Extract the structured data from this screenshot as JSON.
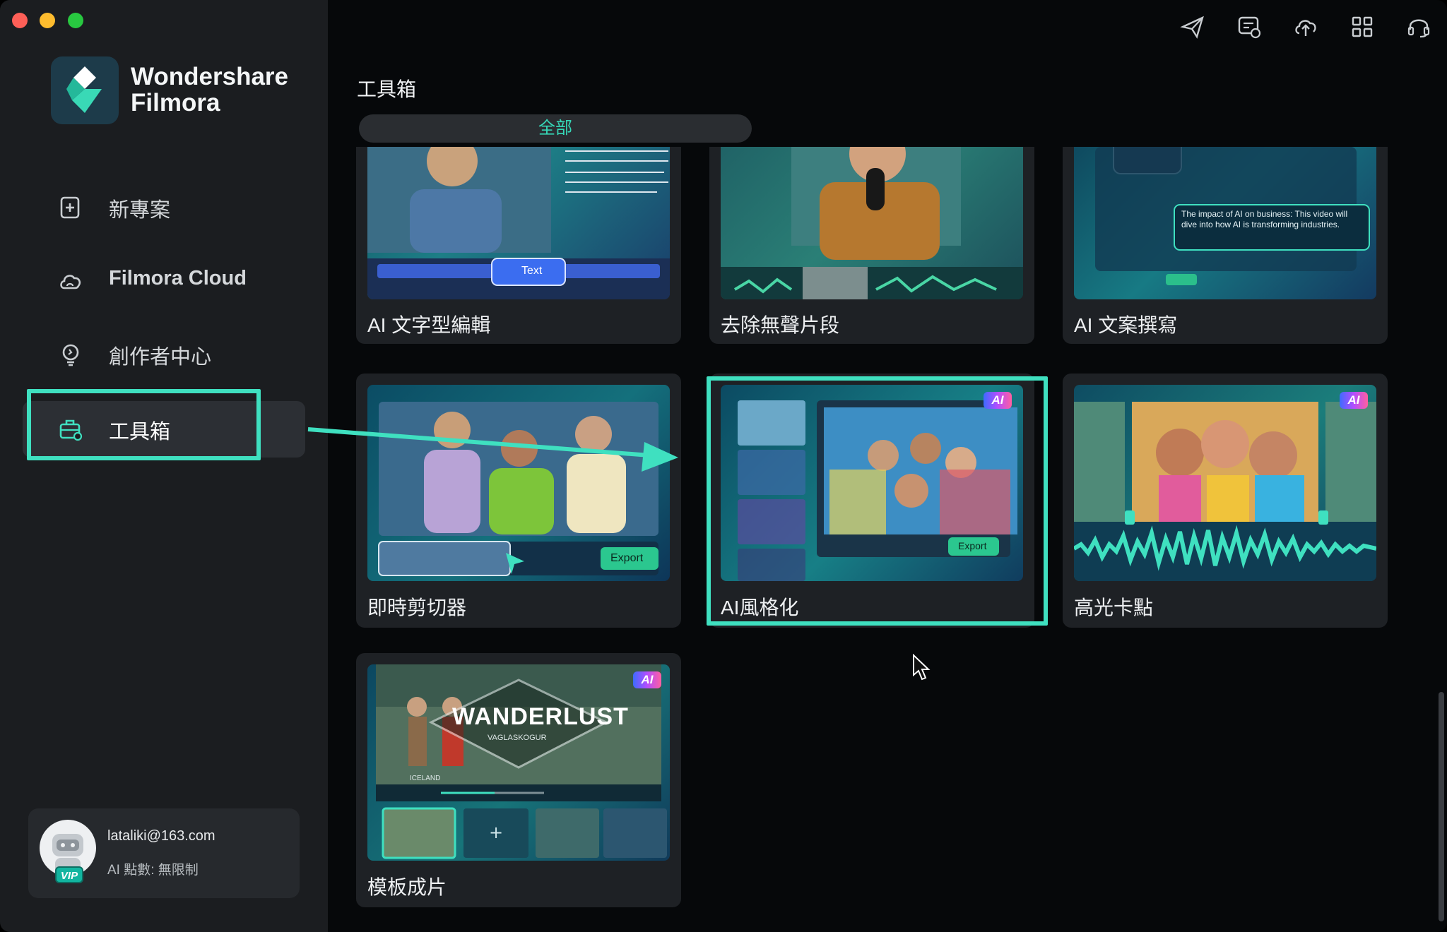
{
  "window": {
    "app_name_line1": "Wondershare",
    "app_name_line2": "Filmora"
  },
  "sidebar": {
    "items": [
      {
        "label": "新專案",
        "icon": "new-project-icon"
      },
      {
        "label": "Filmora Cloud",
        "icon": "cloud-icon"
      },
      {
        "label": "創作者中心",
        "icon": "lightbulb-icon"
      },
      {
        "label": "工具箱",
        "icon": "toolbox-icon",
        "active": true
      }
    ]
  },
  "user": {
    "email": "lataliki@163.com",
    "credits": "AI 點數: 無限制",
    "badge": "VIP"
  },
  "topbar": {
    "icons": [
      "send-icon",
      "message-icon",
      "cloud-upload-icon",
      "grid-icon",
      "headset-icon"
    ]
  },
  "main": {
    "title": "工具箱",
    "tab": "全部",
    "cards": [
      {
        "label": "AI 文字型編輯",
        "thumb_text": "Text"
      },
      {
        "label": "去除無聲片段"
      },
      {
        "label": "AI 文案撰寫",
        "thumb_text": "The impact of AI on business: This video will dive into how AI is transforming industries."
      },
      {
        "label": "即時剪切器",
        "thumb_button": "Export"
      },
      {
        "label": "AI風格化",
        "thumb_button": "Export",
        "badge": "AI"
      },
      {
        "label": "高光卡點",
        "badge": "AI"
      },
      {
        "label": "模板成片",
        "badge": "AI",
        "thumb_title": "WANDERLUST",
        "thumb_subtitle": "VAGLASKOGUR",
        "thumb_tag": "ICELAND"
      }
    ]
  },
  "colors": {
    "accent": "#3fe0c0",
    "sidebar_bg": "#1b1d20",
    "main_bg": "#06080a",
    "card_bg": "#1e2125"
  }
}
